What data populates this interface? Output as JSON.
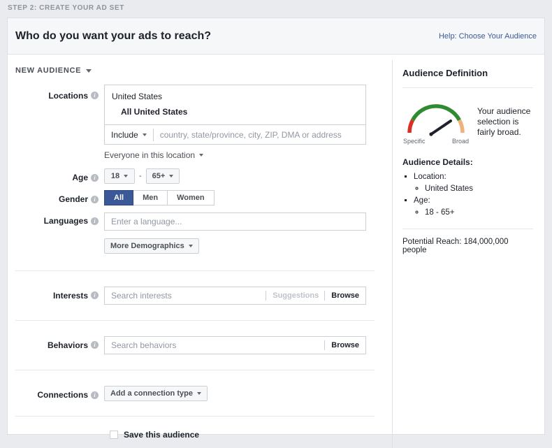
{
  "step_bar": {
    "label": "STEP 2: CREATE YOUR AD SET"
  },
  "header": {
    "title": "Who do you want your ads to reach?",
    "help_link": "Help: Choose Your Audience"
  },
  "audience_selector": {
    "label": "NEW AUDIENCE"
  },
  "form": {
    "locations": {
      "label": "Locations",
      "country": "United States",
      "sub_item": "All United States",
      "include_button": "Include",
      "search_placeholder": "country, state/province, city, ZIP, DMA or address",
      "scope": "Everyone in this location"
    },
    "age": {
      "label": "Age",
      "min": "18",
      "max": "65+",
      "separator": "-"
    },
    "gender": {
      "label": "Gender",
      "options": [
        "All",
        "Men",
        "Women"
      ],
      "selected": "All"
    },
    "languages": {
      "label": "Languages",
      "placeholder": "Enter a language...",
      "value": ""
    },
    "more_demographics": {
      "label": "More Demographics"
    },
    "interests": {
      "label": "Interests",
      "placeholder": "Search interests",
      "value": "",
      "suggestions_label": "Suggestions",
      "browse_label": "Browse"
    },
    "behaviors": {
      "label": "Behaviors",
      "placeholder": "Search behaviors",
      "value": "",
      "browse_label": "Browse"
    },
    "connections": {
      "label": "Connections",
      "button_label": "Add a connection type"
    },
    "save_audience": {
      "label": "Save this audience",
      "checked": false
    }
  },
  "sidebar": {
    "title": "Audience Definition",
    "gauge": {
      "left_label": "Specific",
      "right_label": "Broad",
      "description": "Your audience selection is fairly broad.",
      "colors": {
        "specific": "#d93025",
        "middle": "#2e8b30",
        "broad": "#f0b27a",
        "needle": "#1d2129"
      },
      "needle_angle_deg": 55
    },
    "details_title": "Audience Details:",
    "details": [
      {
        "label": "Location:",
        "values": [
          "United States"
        ]
      },
      {
        "label": "Age:",
        "values": [
          "18 - 65+"
        ]
      }
    ],
    "potential_reach": "Potential Reach: 184,000,000 people"
  },
  "colors": {
    "page_bg": "#e9ebee",
    "card_bg": "#ffffff",
    "accent_blue": "#3b5998",
    "border": "#ccd0d5",
    "text": "#1d2129",
    "muted_text": "#9197a3"
  }
}
